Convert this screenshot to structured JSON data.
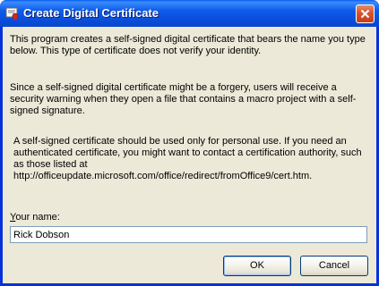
{
  "window": {
    "title": "Create Digital Certificate",
    "colors": {
      "titlebar": "#0a4fdb",
      "client_background": "#ece9d8",
      "close_button": "#d9542d"
    },
    "icons": {
      "app": "certificate-icon",
      "close": "close-icon"
    }
  },
  "content": {
    "paragraph1": "This program creates a self-signed digital certificate that bears the name you type below. This type of certificate does not verify your identity.",
    "paragraph2": "Since a self-signed digital certificate might be a forgery, users will receive a security warning when they open a file that contains a macro project with a self-signed signature.",
    "paragraph3": "A self-signed certificate should be used only for personal use. If you need an authenticated certificate, you might want to contact a certification authority, such as those listed at http://officeupdate.microsoft.com/office/redirect/fromOffice9/cert.htm."
  },
  "form": {
    "name_label_access": "Y",
    "name_label_rest": "our name:",
    "name_value": "Rick Dobson"
  },
  "buttons": {
    "ok_label": "OK",
    "cancel_label": "Cancel"
  }
}
